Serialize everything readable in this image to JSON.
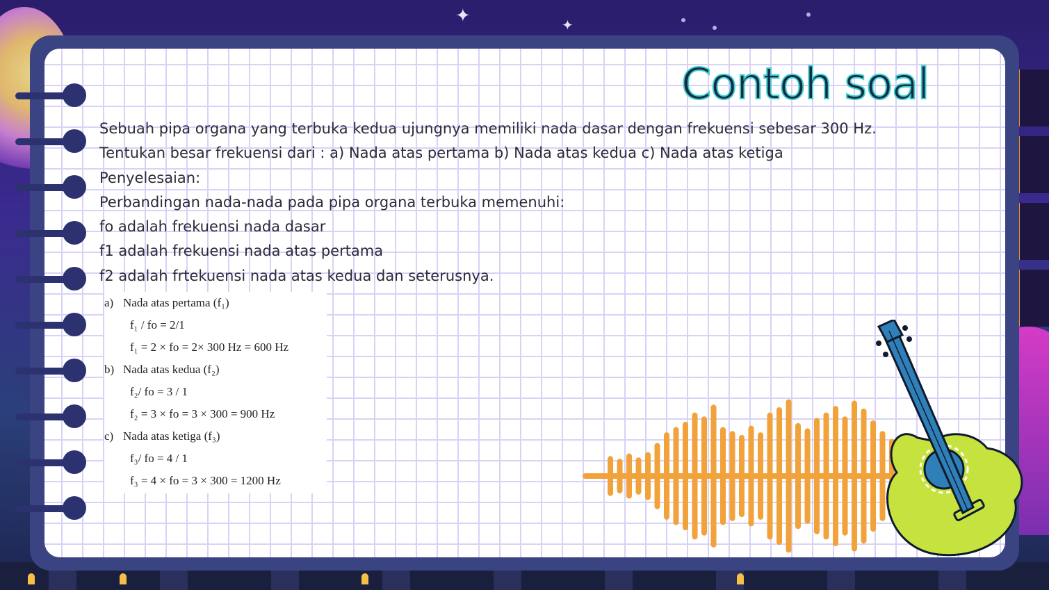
{
  "slide": {
    "title": "Contoh soal",
    "lines": [
      "Sebuah pipa organa yang terbuka kedua ujungnya memiliki nada dasar dengan frekuensi sebesar 300 Hz.",
      "Tentukan besar frekuensi dari : a) Nada atas pertama b) Nada atas kedua c) Nada atas ketiga",
      "Penyelesaian:",
      "Perbandingan nada-nada pada pipa organa terbuka memenuhi:",
      "fo adalah frekuensi nada dasar",
      "f1 adalah frekuensi nada atas pertama",
      "f2 adalah frtekuensi nada atas kedua dan seterusnya."
    ]
  },
  "solution": {
    "a": {
      "label": "a)",
      "title": "Nada atas pertama (f₁)",
      "step1": "f₁ / fo = 2/1",
      "step2": "f₁ = 2 × fo = 2× 300 Hz = 600 Hz"
    },
    "b": {
      "label": "b)",
      "title": "Nada atas kedua (f₂)",
      "step1": "f₂/ fo = 3 / 1",
      "step2": "f₂ = 3 × fo = 3 × 300 = 900 Hz"
    },
    "c": {
      "label": "c)",
      "title": "Nada atas ketiga (f₃)",
      "step1": "f₃/ fo = 4 / 1",
      "step2": "f₃ = 4 × fo = 3 × 300 = 1200 Hz"
    }
  },
  "decor": {
    "icons": [
      "sparkle-star-icon",
      "sound-wave-icon",
      "guitar-icon",
      "notebook-ring-icon"
    ],
    "colors": {
      "background": "#3b2a8f",
      "frame": "#3a4482",
      "grid": "#d9d2f7",
      "title_fill": "#162a44",
      "title_outline": "#3fd0d0",
      "wave": "#f2a23a",
      "guitar_body": "#c6e23f",
      "guitar_neck": "#2f7fb8"
    }
  }
}
